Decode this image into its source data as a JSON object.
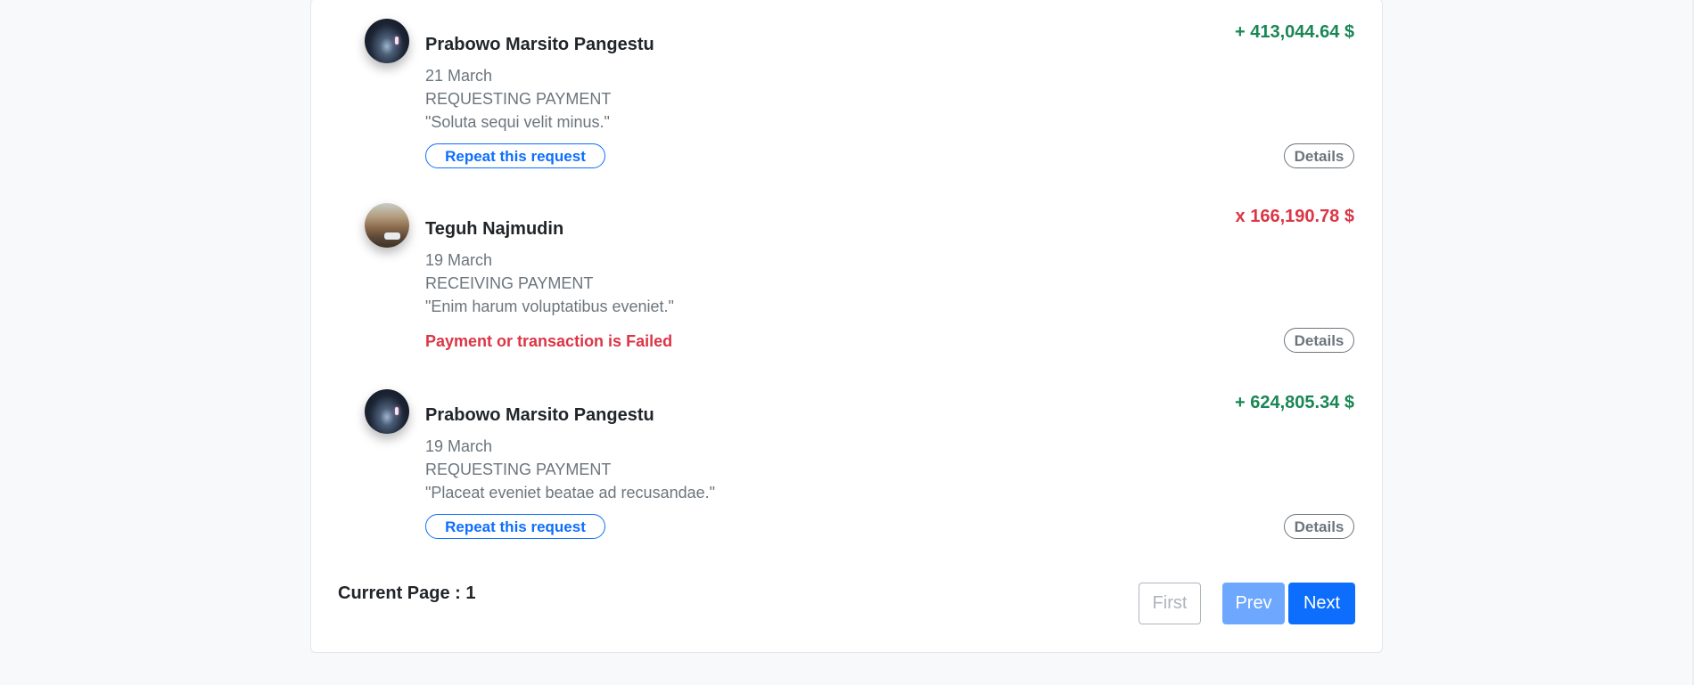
{
  "transactions": [
    {
      "name": "Prabowo Marsito Pangestu",
      "date": "21 March",
      "type": "REQUESTING PAYMENT",
      "note": "\"Soluta sequi velit minus.\"",
      "amount": "+ 413,044.64 $",
      "status": "ok",
      "avatar_icon": "night-sky-avatar",
      "action_label": "Repeat this request",
      "details_label": "Details"
    },
    {
      "name": "Teguh Najmudin",
      "date": "19 March",
      "type": "RECEIVING PAYMENT",
      "note": "\"Enim harum voluptatibus eveniet.\"",
      "amount": "x 166,190.78 $",
      "status": "failed",
      "avatar_icon": "forest-car-avatar",
      "failed_label": "Payment or transaction is Failed",
      "details_label": "Details"
    },
    {
      "name": "Prabowo Marsito Pangestu",
      "date": "19 March",
      "type": "REQUESTING PAYMENT",
      "note": "\"Placeat eveniet beatae ad recusandae.\"",
      "amount": "+ 624,805.34 $",
      "status": "ok",
      "avatar_icon": "night-sky-avatar",
      "action_label": "Repeat this request",
      "details_label": "Details"
    }
  ],
  "pagination": {
    "current_label": "Current Page : 1",
    "first_label": "First",
    "prev_label": "Prev",
    "next_label": "Next"
  },
  "colors": {
    "positive": "#198754",
    "negative": "#dc3545",
    "primary": "#0d6efd",
    "primary_disabled": "#6ea8fe",
    "muted": "#6c757d"
  }
}
